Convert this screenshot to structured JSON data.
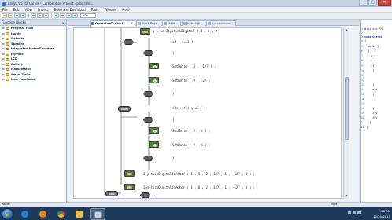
{
  "window": {
    "title": "easyC V5 for Cortex - Competition Project - program..."
  },
  "menu": [
    "File",
    "Edit",
    "View",
    "Project",
    "Build and Download",
    "Tools",
    "Window",
    "Help"
  ],
  "toolbar": {
    "zoom_value": "100"
  },
  "function_blocks": {
    "header": "Function Blocks",
    "items": [
      {
        "label": "Program Flow"
      },
      {
        "label": "Inputs"
      },
      {
        "label": "Outputs"
      },
      {
        "label": "Speaker"
      },
      {
        "label": "Integrated Motor Encoders"
      },
      {
        "label": "Joystick"
      },
      {
        "label": "LCD"
      },
      {
        "label": "Battery"
      },
      {
        "label": "Mathematics"
      },
      {
        "label": "Smart Tasks"
      },
      {
        "label": "User Functions"
      }
    ]
  },
  "tabs": [
    {
      "label": "OperatorControl",
      "active": true
    },
    {
      "label": "Start Page",
      "active": false
    },
    {
      "label": "Main",
      "active": false
    },
    {
      "label": "Initialize",
      "active": false
    },
    {
      "label": "Autonomous",
      "active": false
    }
  ],
  "code": {
    "line1": "y = GetJoystickDigital ( 1 , 6 , 2 )",
    "if_block": "if ( a==1 )",
    "brace_open_1": "{",
    "motor_1": "SetMotor ( 8 , -127 ) ;",
    "motor_2": "SetMotor ( 9 , 127 ) ;",
    "brace_close_1": "}",
    "else_block": "else if ( y==1 )",
    "brace_open_2": "{",
    "motor_3": "SetMotor ( 8 , 0 ) ;",
    "motor_4": "SetMotor ( 9 , 0 ) ;",
    "brace_close_2": "}",
    "joy_1": "JoystickDigitalToMotor ( 1 , 5 , 2 , 127 , 1 , -127 , 3 ) ;",
    "joy_2": "JoystickDigitalToMotor ( 1 , 6 , 2 , 127 , 1 , -127 , 9 ) ;",
    "brace_close_3": "}",
    "brace_close_4": "}"
  },
  "code_panel": {
    "lines": [
      {
        "n": "1",
        "t": "#include \"M"
      },
      {
        "n": "2",
        "t": ""
      },
      {
        "n": "3",
        "t": "void Operat"
      },
      {
        "n": "4",
        "t": "{"
      },
      {
        "n": "5",
        "t": "  while ("
      },
      {
        "n": "6",
        "t": "  {"
      },
      {
        "n": "7",
        "t": "    a ="
      },
      {
        "n": "8",
        "t": "    y ="
      },
      {
        "n": "9",
        "t": "    if"
      },
      {
        "n": "10",
        "t": "    {"
      },
      {
        "n": "11",
        "t": ""
      },
      {
        "n": "12",
        "t": ""
      },
      {
        "n": "13",
        "t": "    }"
      },
      {
        "n": "14",
        "t": "    els"
      },
      {
        "n": "15",
        "t": "    {"
      },
      {
        "n": "16",
        "t": ""
      },
      {
        "n": "17",
        "t": ""
      },
      {
        "n": "18",
        "t": "    }"
      },
      {
        "n": "19",
        "t": "    Joy"
      },
      {
        "n": "20",
        "t": "    Joy"
      },
      {
        "n": "21",
        "t": "  }"
      },
      {
        "n": "22",
        "t": "}"
      }
    ]
  },
  "status": {
    "left": "Ready",
    "caps": "NUM",
    "clock_time": "7:56 AM",
    "clock_date": "10/30/2015"
  },
  "taskbar": {
    "apps": [
      "explorer",
      "media-player",
      "chrome",
      "folder",
      "easyc"
    ]
  }
}
